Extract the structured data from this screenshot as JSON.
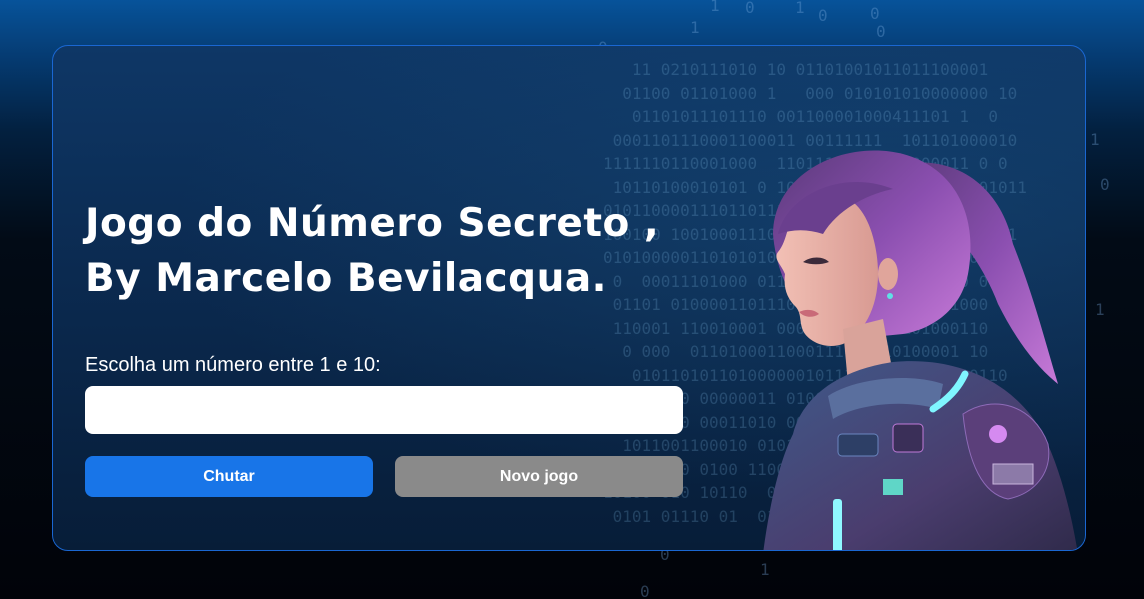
{
  "header": {
    "title_line1": "Jogo do Número Secreto ,",
    "title_line2": "By Marcelo Bevilacqua."
  },
  "form": {
    "prompt": "Escolha um número entre 1 e 10:",
    "input_value": "",
    "input_placeholder": ""
  },
  "buttons": {
    "guess_label": "Chutar",
    "new_game_label": "Novo jogo"
  },
  "colors": {
    "card_border": "#1a67d2",
    "primary_button": "#1875e8",
    "secondary_button": "#8a8a8a",
    "title_text": "#ffffff"
  },
  "illustration": {
    "subject": "robot-woman-illustration"
  }
}
